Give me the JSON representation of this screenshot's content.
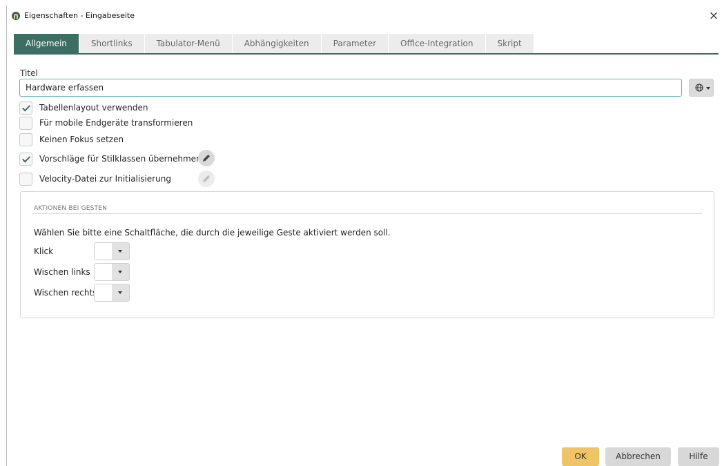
{
  "window": {
    "title": "Eigenschaften - Eingabeseite",
    "close_glyph": "×"
  },
  "tabs": [
    {
      "label": "Allgemein",
      "active": true
    },
    {
      "label": "Shortlinks",
      "active": false
    },
    {
      "label": "Tabulator-Menü",
      "active": false
    },
    {
      "label": "Abhängigkeiten",
      "active": false
    },
    {
      "label": "Parameter",
      "active": false
    },
    {
      "label": "Office-Integration",
      "active": false
    },
    {
      "label": "Skript",
      "active": false
    }
  ],
  "title_field": {
    "label": "Titel",
    "value": "Hardware erfassen",
    "language_button_icon": "globe-icon"
  },
  "checkboxes": [
    {
      "label": "Tabellenlayout verwenden",
      "checked": true
    },
    {
      "label": "Für mobile Endgeräte transformieren",
      "checked": false
    },
    {
      "label": "Keinen Fokus setzen",
      "checked": false
    },
    {
      "label": "Vorschläge für Stilklassen übernehmen",
      "checked": true
    },
    {
      "label": "Velocity-Datei zur Initialisierung",
      "checked": false
    }
  ],
  "gestures": {
    "group_title": "AKTIONEN BEI GESTEN",
    "instruction": "Wählen Sie bitte eine Schaltfläche, die durch die jeweilige Geste aktiviert werden soll.",
    "rows": [
      {
        "label": "Klick",
        "value": ""
      },
      {
        "label": "Wischen links",
        "value": ""
      },
      {
        "label": "Wischen rechts",
        "value": ""
      }
    ]
  },
  "footer": {
    "ok_label": "OK",
    "cancel_label": "Abbrechen",
    "help_label": "Hilfe"
  },
  "colors": {
    "accent": "#3d6e64",
    "input_focus": "#5fb0ad",
    "ok_button": "#efc466"
  }
}
